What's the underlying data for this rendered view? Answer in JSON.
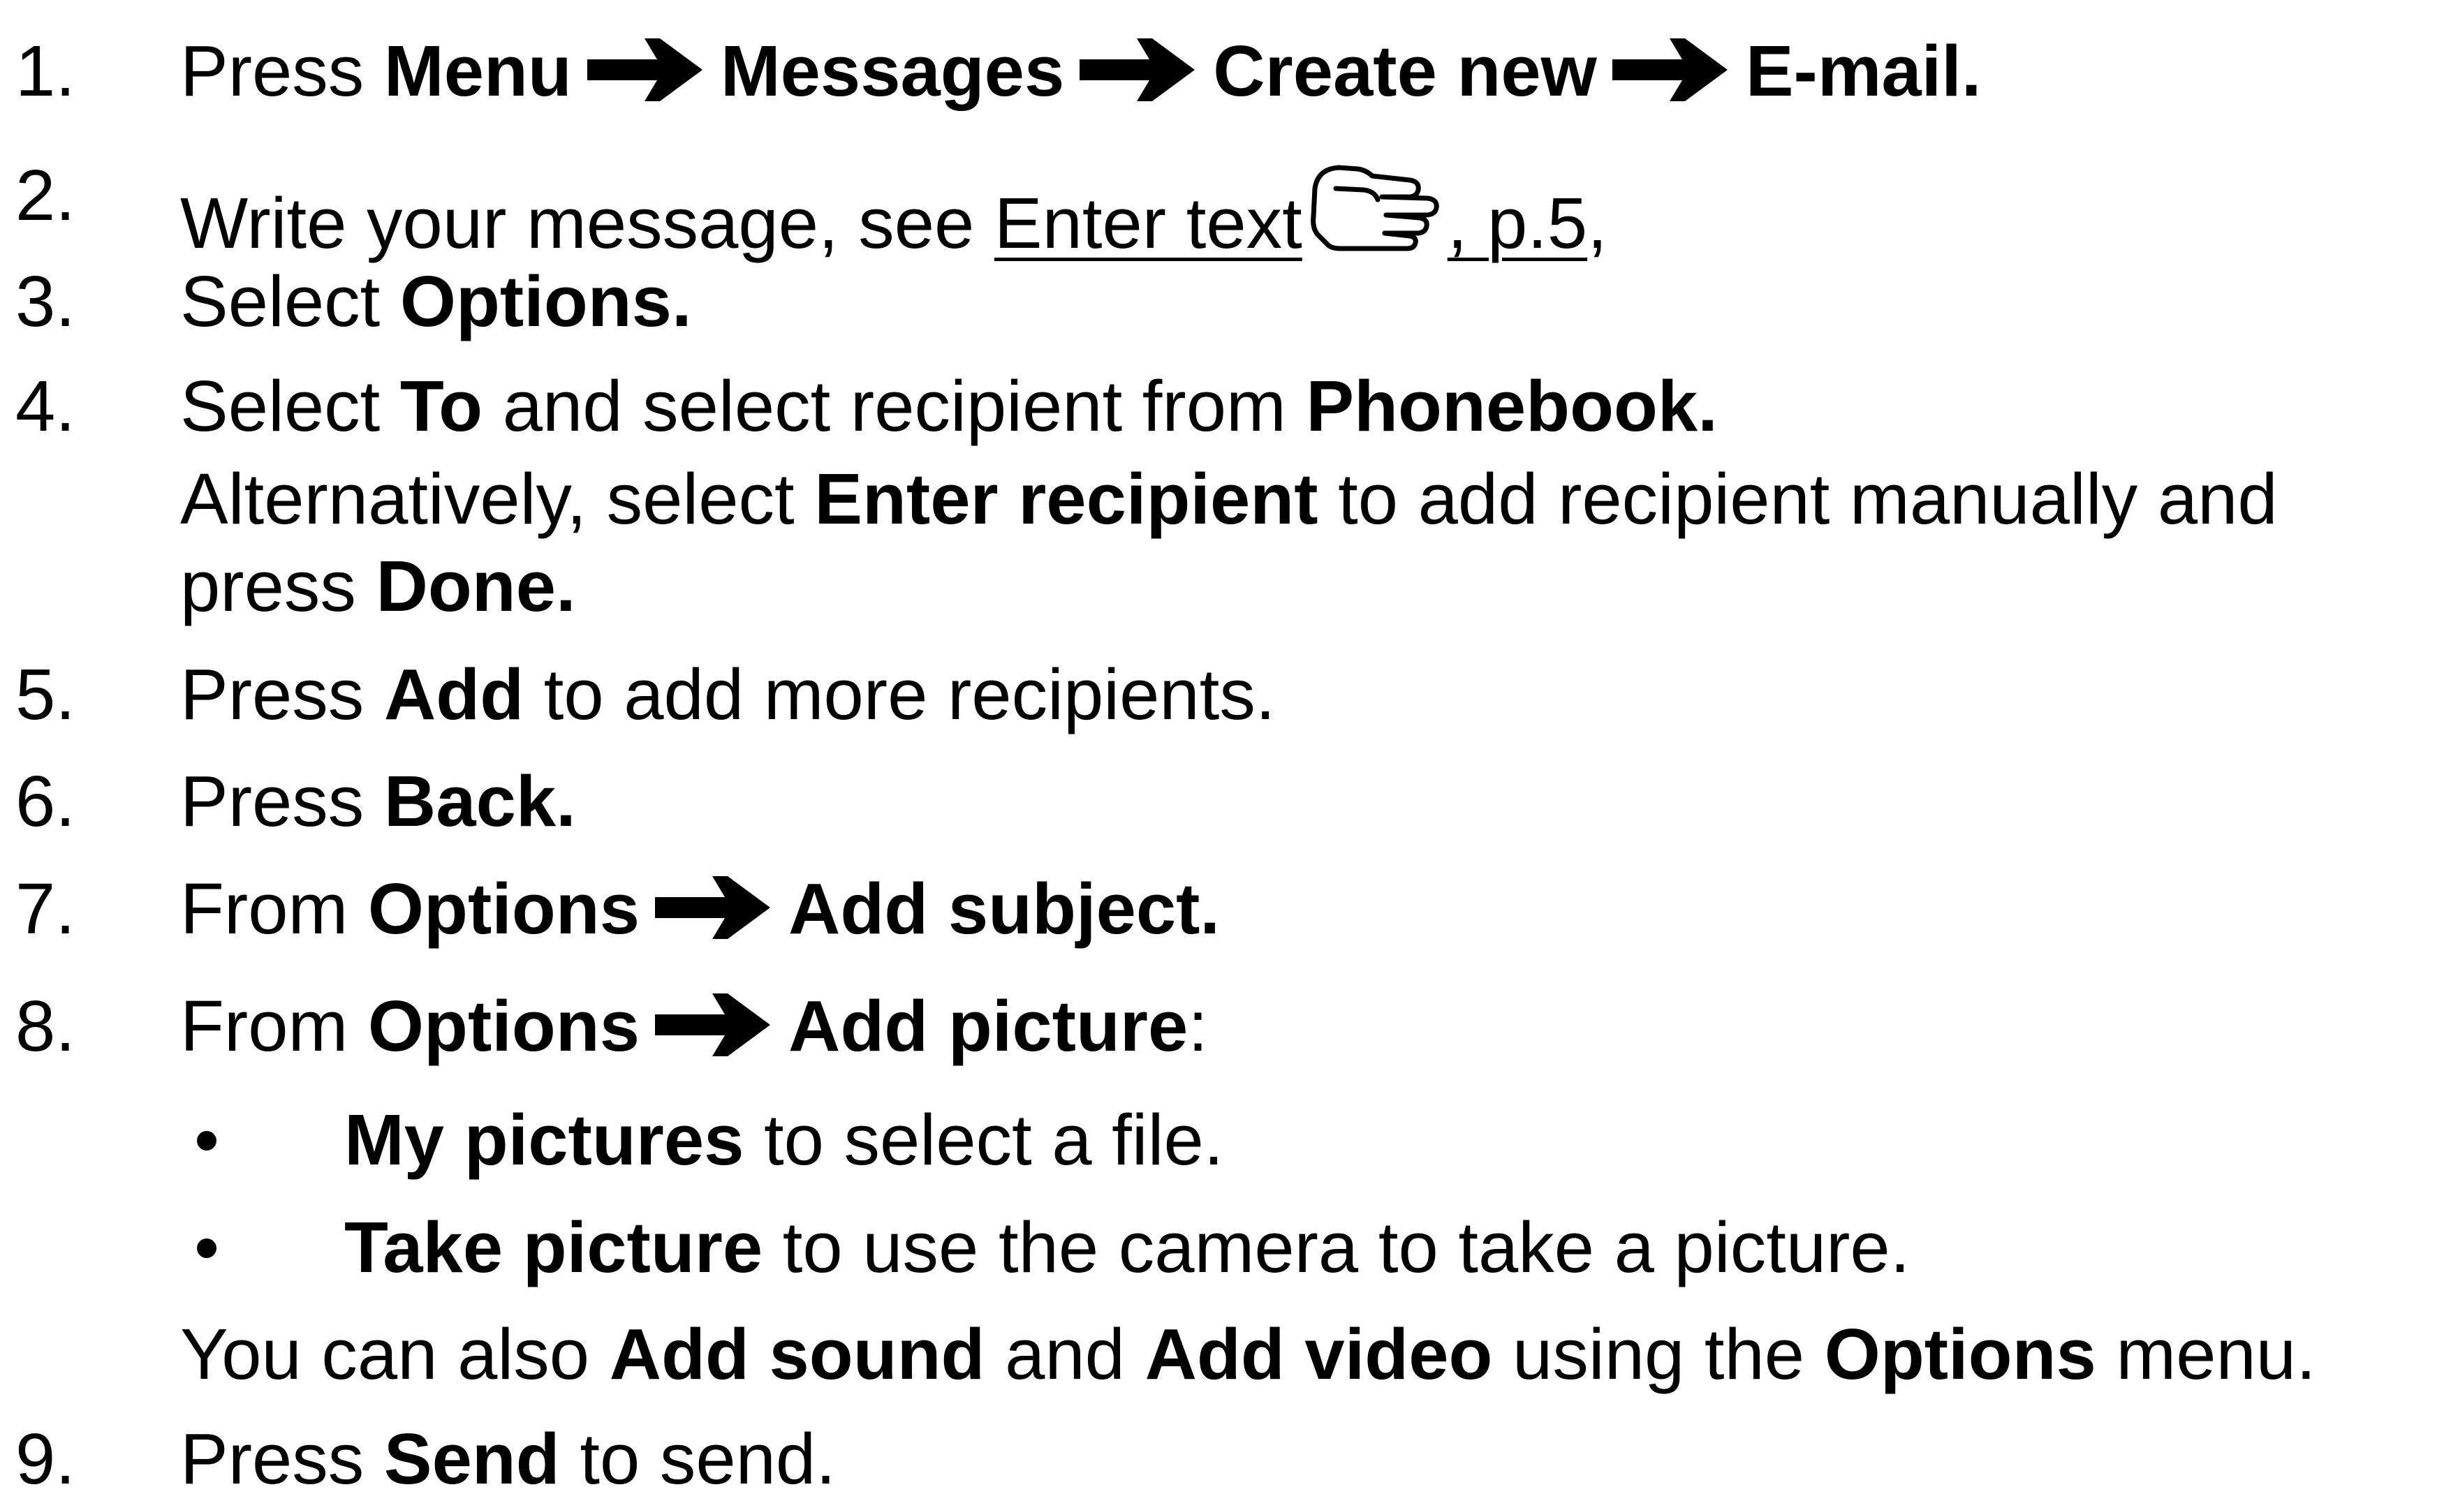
{
  "steps": [
    {
      "number": "1.",
      "t1": "Press ",
      "b1": "Menu",
      "b2": "Messages",
      "b3": "Create new",
      "b4": "E-mail."
    },
    {
      "number": "2.",
      "t1": "Write your message, see ",
      "link_text": "Enter text",
      "link_page": ", p.5",
      "t2": ","
    },
    {
      "number": "3.",
      "t1": "Select ",
      "b1": "Options."
    },
    {
      "number": "4.",
      "t1": "Select ",
      "b1": "To",
      "t2": " and select recipient from ",
      "b2": "Phonebook.",
      "line2_t1": "Alternatively, select ",
      "line2_b1": "Enter recipient",
      "line2_t2": " to add recipient manually and",
      "line3_t1": "press ",
      "line3_b1": "Done."
    },
    {
      "number": "5.",
      "t1": "Press ",
      "b1": "Add",
      "t2": " to add more recipients."
    },
    {
      "number": "6.",
      "t1": "Press ",
      "b1": "Back."
    },
    {
      "number": "7.",
      "t1": "From ",
      "b1": "Options",
      "b2": "Add subject."
    },
    {
      "number": "8.",
      "t1": "From ",
      "b1": "Options",
      "b2": "Add picture",
      "t2": ":",
      "bullets": [
        {
          "bullet": "•",
          "b1": "My pictures",
          "t1": " to select a file."
        },
        {
          "bullet": "•",
          "b1": "Take picture",
          "t1": " to use the camera to take a picture."
        }
      ],
      "note_t1": "You can also ",
      "note_b1": "Add sound",
      "note_t2": " and ",
      "note_b2": "Add video",
      "note_t3": " using the ",
      "note_b3": "Options",
      "note_t4": " menu."
    },
    {
      "number": "9.",
      "t1": "Press ",
      "b1": "Send",
      "t2": " to send."
    }
  ],
  "icons": {
    "arrow": "right-arrow-icon",
    "pointer": "pointing-hand-icon"
  }
}
